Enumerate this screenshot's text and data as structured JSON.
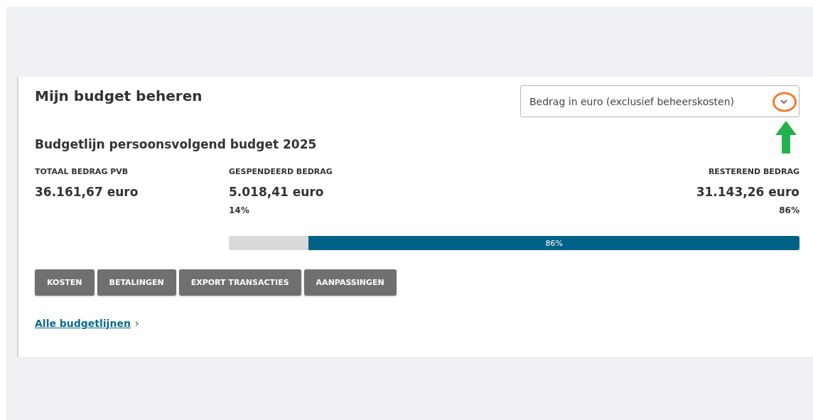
{
  "title": "Mijn budget beheren",
  "dropdown": {
    "value": "Bedrag in euro (exclusief beheerskosten)"
  },
  "callouts": [
    {
      "kind": "circle",
      "color": "#f07b2b"
    },
    {
      "kind": "arrow",
      "color": "#23b14d"
    }
  ],
  "budget_line": {
    "title": "Budgetlijn persoonsvolgend budget 2025",
    "total": {
      "label": "TOTAAL BEDRAG PVB",
      "amount": "36.161,67 euro"
    },
    "spent": {
      "label": "GESPENDEERD BEDRAG",
      "amount": "5.018,41 euro",
      "percent": "14%"
    },
    "remaining": {
      "label": "RESTEREND BEDRAG",
      "amount": "31.143,26 euro",
      "percent": "86%"
    },
    "progress": {
      "level": 0.86,
      "label": "86%"
    }
  },
  "buttons": [
    "KOSTEN",
    "BETALINGEN",
    "EXPORT TRANSACTIES",
    "AANPASSINGEN"
  ],
  "link": {
    "label": "Alle budgetlijnen",
    "chevron": "›"
  }
}
